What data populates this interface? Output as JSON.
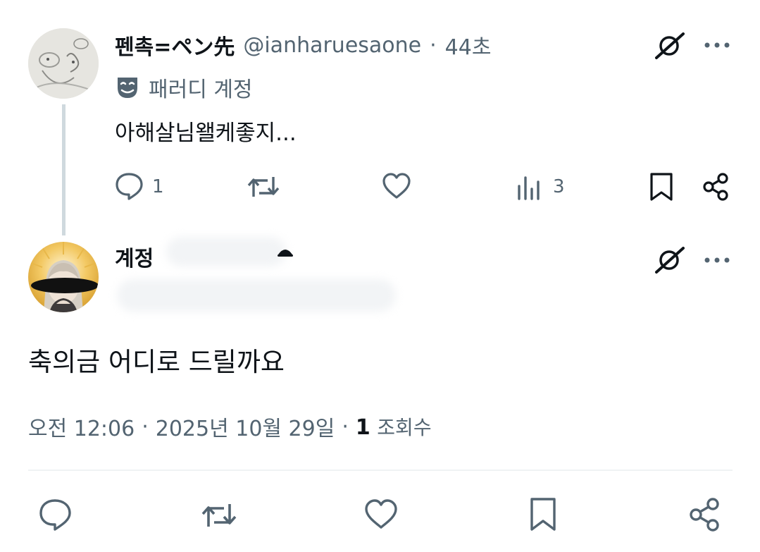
{
  "post1": {
    "display_name": "펜촉=ペン先",
    "handle": "@ianharuesaone",
    "separator": "·",
    "time_ago": "44초",
    "label": "패러디 계정",
    "text": "아해살님왤케좋지...",
    "actions": {
      "reply_count": "1",
      "retweet_count": "",
      "like_count": "",
      "views_count": "3"
    }
  },
  "post2": {
    "display_name": "계정",
    "text": "축의금 어디로 드릴까요",
    "meta": {
      "time": "오전 12:06",
      "sep1": "·",
      "date": "2025년 10월 29일",
      "sep2": "·",
      "views_number": "1",
      "views_label": "조회수"
    }
  },
  "icons": {
    "grok": "grok-icon",
    "more": "more-icon",
    "reply": "reply-icon",
    "retweet": "retweet-icon",
    "like": "heart-icon",
    "views": "views-icon",
    "bookmark": "bookmark-icon",
    "share": "share-icon",
    "parody": "theater-mask-icon"
  },
  "colors": {
    "text_primary": "#0f1419",
    "text_secondary": "#536471",
    "thread_line": "#cfd9de",
    "divider": "#eff3f4"
  }
}
